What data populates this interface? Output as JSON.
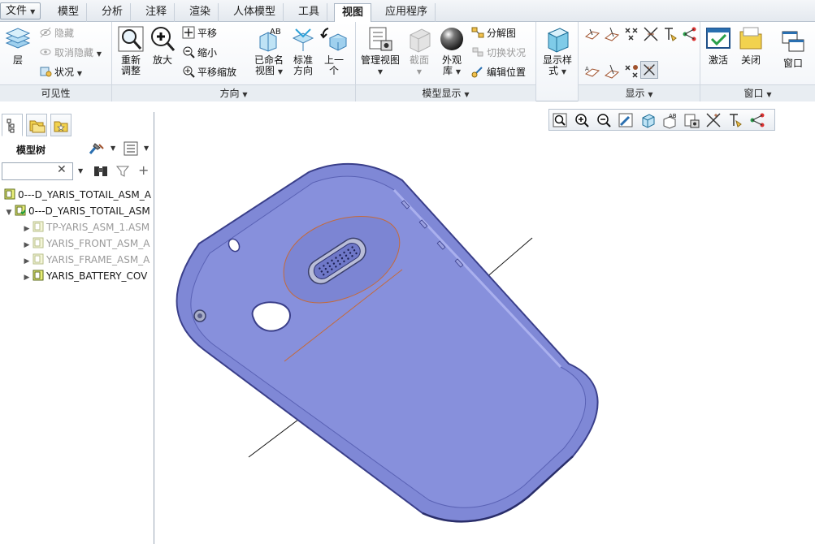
{
  "menu": {
    "file": "文件",
    "tabs": [
      "模型",
      "分析",
      "注释",
      "渲染",
      "人体模型",
      "工具",
      "视图",
      "应用程序"
    ],
    "active_tab": "视图"
  },
  "ribbon": {
    "visibility": {
      "label": "可见性",
      "layer": "层",
      "hide": "隐藏",
      "unhide": "取消隐藏",
      "status": "状况"
    },
    "orientation": {
      "label": "方向",
      "refit_line1": "重新",
      "refit_line2": "调整",
      "zoom_in": "放大",
      "pan": "平移",
      "zoom_out": "缩小",
      "pan_zoom": "平移缩放",
      "named_view_line1": "已命名",
      "named_view_line2": "视图",
      "standard_line1": "标准",
      "standard_line2": "方向",
      "prev_line1": "上一",
      "prev_line2": "个"
    },
    "model_display": {
      "label": "模型显示",
      "manage_line1": "管理视图",
      "section": "截面",
      "appearance_line1": "外观",
      "appearance_line2": "库",
      "exploded": "分解图",
      "toggle_status": "切换状况",
      "edit_position": "编辑位置"
    },
    "display_style": {
      "label_line1": "显示样",
      "label_line2": "式"
    },
    "show": {
      "label": "显示"
    },
    "window": {
      "label": "窗口",
      "activate": "激活",
      "close": "关闭",
      "windows": "窗口"
    }
  },
  "left_panel": {
    "tree_title": "模型树",
    "search_value": "",
    "items": [
      {
        "label": "0---D_YARIS_TOTAIL_ASM_A",
        "dim": false
      },
      {
        "label": "0---D_YARIS_TOTAIL_ASM",
        "dim": false
      },
      {
        "label": "TP-YARIS_ASM_1.ASM",
        "dim": true
      },
      {
        "label": "YARIS_FRONT_ASM_A",
        "dim": true
      },
      {
        "label": "YARIS_FRAME_ASM_A",
        "dim": true
      },
      {
        "label": "YARIS_BATTERY_COV",
        "dim": false
      }
    ]
  },
  "colors": {
    "model_fill": "#7f88d6",
    "model_edge": "#3a3f8a",
    "ribbon_bg": "#f1f4f8"
  }
}
